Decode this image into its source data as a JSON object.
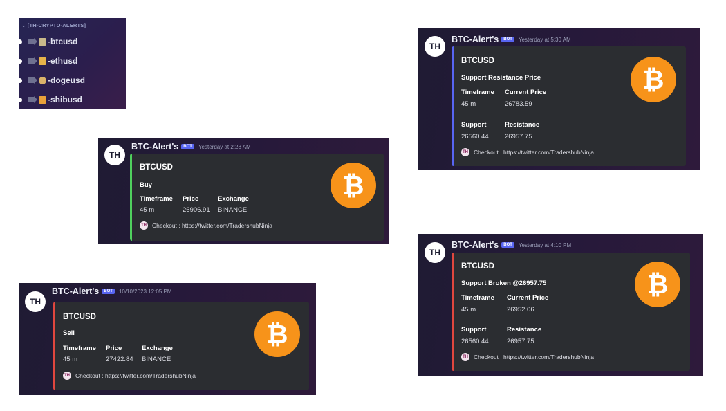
{
  "channels": {
    "category": "⌄ [TH-CRYPTO-ALERTS]",
    "items": [
      {
        "label": "-btcusd",
        "emoji_color": "#c8b98a"
      },
      {
        "label": "-ethusd",
        "emoji_color": "#e6b34a"
      },
      {
        "label": "-dogeusd",
        "emoji_color": "#d9b36a"
      },
      {
        "label": "-shibusd",
        "emoji_color": "#e8a13a"
      }
    ]
  },
  "messages": {
    "buy": {
      "author": "BTC-Alert's",
      "bot_tag": "BOT",
      "avatar": "TH",
      "timestamp": "Yesterday at 2:28 AM",
      "accent": "#4fd15d",
      "title": "BTCUSD",
      "subtitle": "Buy",
      "fields": [
        {
          "label": "Timeframe",
          "value": "45 m"
        },
        {
          "label": "Price",
          "value": "26906.91"
        },
        {
          "label": "Exchange",
          "value": "BINANCE"
        }
      ],
      "footer_icon": "TH",
      "footer": "Checkout : https://twitter.com/TradershubNinja",
      "icon": "bitcoin-logo"
    },
    "sell": {
      "author": "BTC-Alert's",
      "bot_tag": "BOT",
      "avatar": "TH",
      "timestamp": "10/10/2023 12:05 PM",
      "accent": "#e0473e",
      "title": "BTCUSD",
      "subtitle": "Sell",
      "fields": [
        {
          "label": "Timeframe",
          "value": "45 m"
        },
        {
          "label": "Price",
          "value": "27422.84"
        },
        {
          "label": "Exchange",
          "value": "BINANCE"
        }
      ],
      "footer_icon": "TH",
      "footer": "Checkout : https://twitter.com/TradershubNinja",
      "icon": "bitcoin-logo"
    },
    "resistance": {
      "author": "BTC-Alert's",
      "bot_tag": "BOT",
      "avatar": "TH",
      "timestamp": "Yesterday at 5:30 AM",
      "accent": "#5865f2",
      "title": "BTCUSD",
      "subtitle": "Support Resistance Price",
      "fields": [
        {
          "label": "Timeframe",
          "value": "45 m"
        },
        {
          "label": "Current Price",
          "value": "26783.59"
        },
        {
          "label": "Support",
          "value": "26560.44"
        },
        {
          "label": "Resistance",
          "value": "26957.75"
        }
      ],
      "footer_icon": "TH",
      "footer": "Checkout : https://twitter.com/TradershubNinja",
      "icon": "bitcoin-logo"
    },
    "broken": {
      "author": "BTC-Alert's",
      "bot_tag": "BOT",
      "avatar": "TH",
      "timestamp": "Yesterday at 4:10 PM",
      "accent": "#e0473e",
      "title": "BTCUSD",
      "subtitle": "Support Broken @26957.75",
      "fields": [
        {
          "label": "Timeframe",
          "value": "45 m"
        },
        {
          "label": "Current Price",
          "value": "26952.06"
        },
        {
          "label": "Support",
          "value": "26560.44"
        },
        {
          "label": "Resistance",
          "value": "26957.75"
        }
      ],
      "footer_icon": "TH",
      "footer": "Checkout : https://twitter.com/TradershubNinja",
      "icon": "bitcoin-logo"
    }
  },
  "bitcoin_glyph": "₿",
  "colors": {
    "bitcoin": "#f7931a",
    "bot_badge": "#5865f2",
    "embed_bg": "#2b2d31"
  }
}
